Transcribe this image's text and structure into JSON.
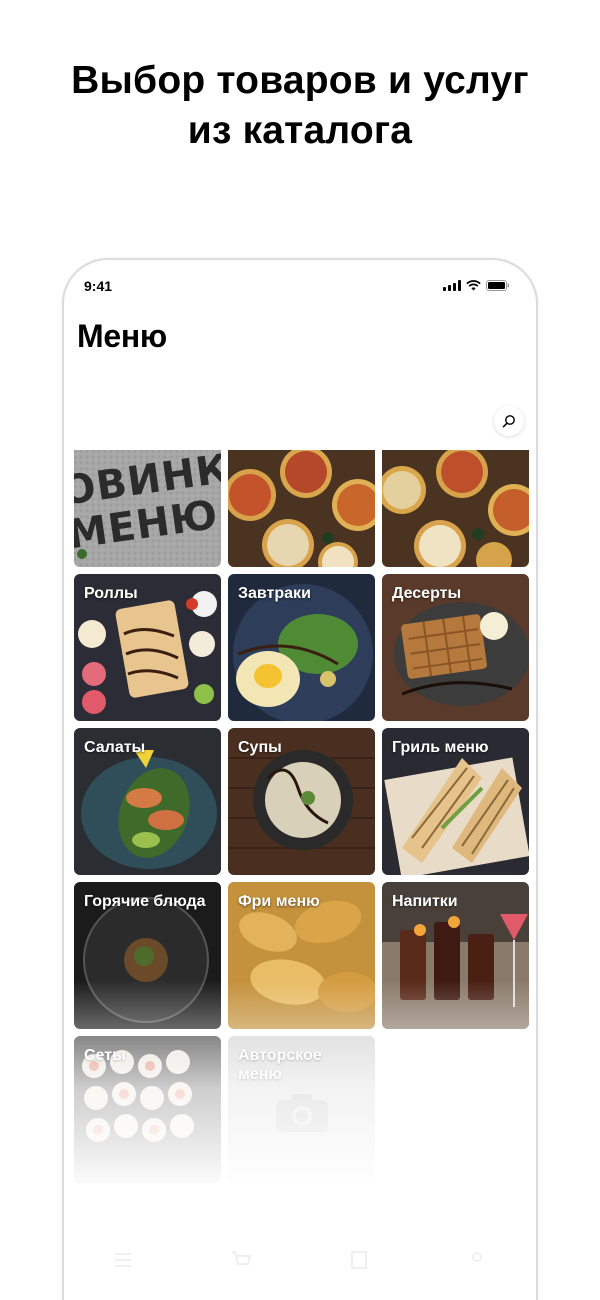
{
  "headline": {
    "line1": "Выбор товаров и услуг",
    "line2": "из каталога"
  },
  "status_bar": {
    "time": "9:41"
  },
  "screen": {
    "title": "Меню",
    "search_icon": "search-icon"
  },
  "banners": [
    {
      "name": "novinki-banner",
      "text_line1": "ОВИНК",
      "text_line2": "МЕНЮ",
      "color": "#9a9a9a"
    },
    {
      "name": "pizza-banner-1",
      "color": "#5b3a1e"
    },
    {
      "name": "pizza-banner-2",
      "color": "#5b3a1e"
    }
  ],
  "categories": [
    {
      "label": "Роллы",
      "color": "#3a3a44"
    },
    {
      "label": "Завтраки",
      "color": "#2a3a52"
    },
    {
      "label": "Десерты",
      "color": "#4a3b33"
    },
    {
      "label": "Салаты",
      "color": "#2f3a40"
    },
    {
      "label": "Супы",
      "color": "#3d2a20"
    },
    {
      "label": "Гриль меню",
      "color": "#2a2a35"
    },
    {
      "label": "Горячие блюда",
      "color": "#1f1f1f"
    },
    {
      "label": "Фри меню",
      "color": "#c89a4a"
    },
    {
      "label": "Напитки",
      "color": "#3b3430"
    },
    {
      "label": "Сеты",
      "color": "#b8a89a"
    },
    {
      "label": "Авторское меню",
      "color": "#cfcfcf"
    }
  ],
  "tab_bar": {
    "icons": [
      "menu-icon",
      "cart-icon",
      "orders-icon",
      "profile-icon"
    ]
  }
}
